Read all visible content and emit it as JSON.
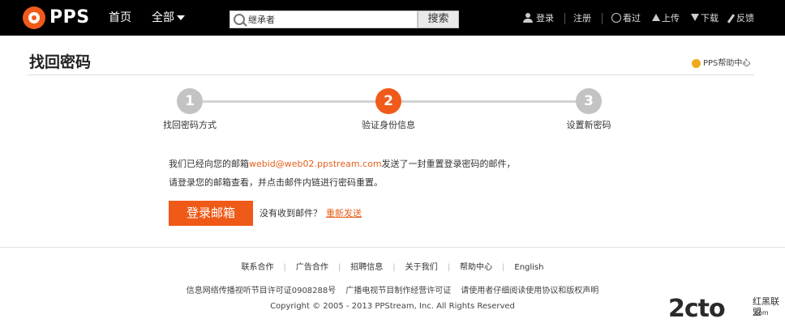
{
  "header": {
    "logo_text": "PPS",
    "nav": {
      "home": "首页",
      "all": "全部"
    },
    "search": {
      "value": "继承者",
      "button": "搜索"
    },
    "user": {
      "login": "登录",
      "register": "注册"
    },
    "tools": {
      "history": "看过",
      "upload": "上传",
      "download": "下载",
      "feedback": "反馈"
    }
  },
  "page": {
    "title": "找回密码",
    "help": "PPS帮助中心"
  },
  "steps": [
    {
      "num": "1",
      "label": "找回密码方式"
    },
    {
      "num": "2",
      "label": "验证身份信息"
    },
    {
      "num": "3",
      "label": "设置新密码"
    }
  ],
  "message": {
    "prefix": "我们已经向您的邮箱",
    "email": "webid@web02.ppstream.com",
    "suffix": "发送了一封重置登录密码的邮件，",
    "line2": "请登录您的邮箱查看，并点击邮件内链进行密码重置。",
    "login_button": "登录邮箱",
    "no_mail": "没有收到邮件？",
    "resend": "重新发送"
  },
  "footer": {
    "links": [
      "联系合作",
      "广告合作",
      "招聘信息",
      "关于我们",
      "帮助中心",
      "English"
    ],
    "license": [
      "信息网络传播视听节目许可证0908288号",
      "广播电视节目制作经营许可证",
      "请使用者仔细阅读使用协议和版权声明"
    ],
    "copyright": "Copyright © 2005 - 2013 PPStream, Inc. All Rights Reserved"
  },
  "watermark": {
    "main": "2cto",
    "sub": "红黑联盟",
    "sub2": ".com"
  }
}
